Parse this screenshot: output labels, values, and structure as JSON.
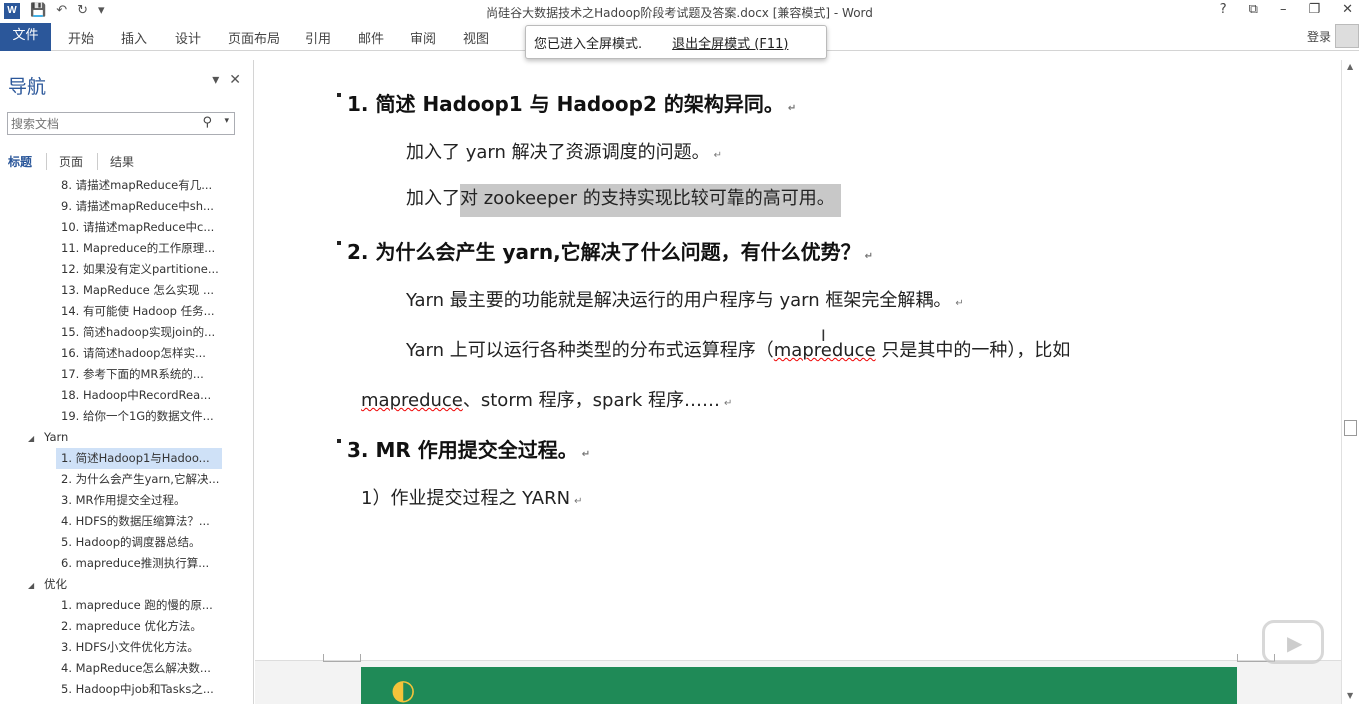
{
  "window": {
    "title": "尚硅谷大数据技术之Hadoop阶段考试题及答案.docx [兼容模式] - Word",
    "controls": [
      "?",
      "⧉",
      "–",
      "❐",
      "✕"
    ]
  },
  "ribbon": {
    "tabs": [
      "文件",
      "开始",
      "插入",
      "设计",
      "页面布局",
      "引用",
      "邮件",
      "审阅",
      "视图"
    ],
    "login": "登录"
  },
  "toast": {
    "message": "您已进入全屏模式.",
    "exit": "退出全屏模式 (F11)"
  },
  "nav": {
    "title": "导航",
    "search_placeholder": "搜索文档",
    "tabs": [
      "标题",
      "页面",
      "结果"
    ],
    "items": [
      {
        "text": "8. 请描述mapReduce有几...",
        "level": 2
      },
      {
        "text": "9. 请描述mapReduce中sh...",
        "level": 2
      },
      {
        "text": "10. 请描述mapReduce中c...",
        "level": 2
      },
      {
        "text": "11. Mapreduce的工作原理...",
        "level": 2
      },
      {
        "text": "12. 如果没有定义partitione...",
        "level": 2
      },
      {
        "text": "13. MapReduce 怎么实现 ...",
        "level": 2
      },
      {
        "text": "14. 有可能使 Hadoop 任务...",
        "level": 2
      },
      {
        "text": "15. 简述hadoop实现join的...",
        "level": 2
      },
      {
        "text": "16. 请简述hadoop怎样实...",
        "level": 2
      },
      {
        "text": "17.  参考下面的MR系统的...",
        "level": 2
      },
      {
        "text": "18. Hadoop中RecordRea...",
        "level": 2
      },
      {
        "text": "19. 给你一个1G的数据文件...",
        "level": 2
      },
      {
        "text": "Yarn",
        "level": 1
      },
      {
        "text": "1. 简述Hadoop1与Hadoo...",
        "level": 2,
        "selected": true
      },
      {
        "text": "2. 为什么会产生yarn,它解决...",
        "level": 2
      },
      {
        "text": "3. MR作用提交全过程。",
        "level": 2
      },
      {
        "text": "4. HDFS的数据压缩算法？...",
        "level": 2
      },
      {
        "text": "5. Hadoop的调度器总结。",
        "level": 2
      },
      {
        "text": "6. mapreduce推测执行算...",
        "level": 2
      },
      {
        "text": "优化",
        "level": 1
      },
      {
        "text": "1. mapreduce 跑的慢的原...",
        "level": 2
      },
      {
        "text": "2. mapreduce 优化方法。",
        "level": 2
      },
      {
        "text": "3. HDFS小文件优化方法。",
        "level": 2
      },
      {
        "text": "4. MapReduce怎么解决数...",
        "level": 2
      },
      {
        "text": "5. Hadoop中job和Tasks之...",
        "level": 2
      }
    ]
  },
  "document": {
    "h1": "1. 简述 Hadoop1 与 Hadoop2  的架构异同。",
    "p1": "加入了 yarn 解决了资源调度的问题。",
    "p2a": "加入了",
    "p2b": "对 zookeeper 的支持实现比较可靠的高可用。",
    "h2": "2. 为什么会产生 yarn,它解决了什么问题，有什么优势？",
    "p3": "Yarn 最主要的功能就是解决运行的用户程序与 yarn 框架完全解耦。",
    "p4a": "Yarn  上可以运行各种类型的分布式运算程序（",
    "p4b": "mapreduce",
    "p4c": " 只是其中的一种），比如",
    "p5a": "mapreduce",
    "p5b": "、storm 程序，spark 程序……",
    "h3": "3. MR 作用提交全过程。",
    "p6": "1）作业提交过程之 YARN"
  }
}
